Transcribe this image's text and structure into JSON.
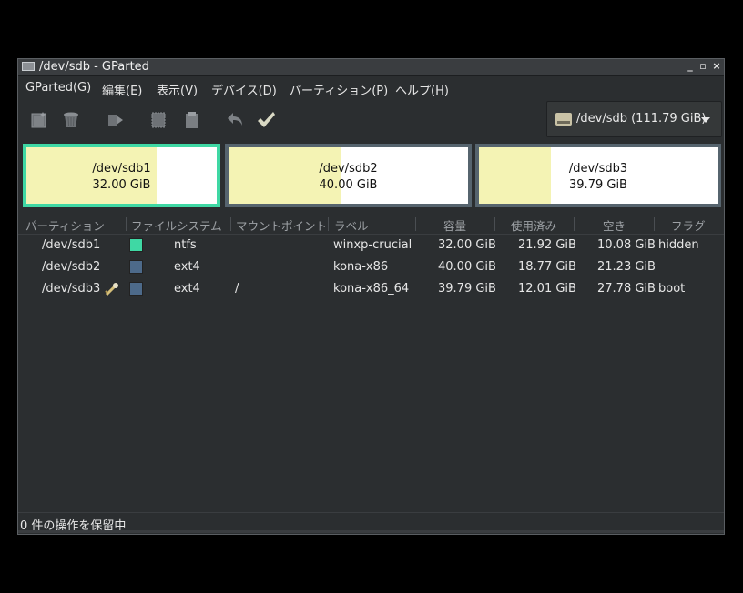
{
  "window": {
    "title": "/dev/sdb - GParted"
  },
  "menu": [
    "GParted(G)",
    "編集(E)",
    "表示(V)",
    "デバイス(D)",
    "パーティション(P)",
    "ヘルプ(H)"
  ],
  "toolbar": {
    "icons": [
      "new-partition-icon",
      "delete-icon",
      "resize-move-icon",
      "copy-icon",
      "paste-icon",
      "undo-icon",
      "apply-icon"
    ]
  },
  "device": {
    "label": "/dev/sdb   (111.79 GiB)",
    "icon": "harddisk-icon"
  },
  "partitions_map": [
    {
      "name": "/dev/sdb1",
      "size": "32.00 GiB",
      "used_fraction": 0.685,
      "selected": true
    },
    {
      "name": "/dev/sdb2",
      "size": "40.00 GiB",
      "used_fraction": 0.469,
      "selected": false
    },
    {
      "name": "/dev/sdb3",
      "size": "39.79 GiB",
      "used_fraction": 0.302,
      "selected": false
    }
  ],
  "columns": [
    "パーティション",
    "ファイルシステム",
    "マウントポイント",
    "ラベル",
    "容量",
    "使用済み",
    "空き",
    "フラグ"
  ],
  "rows": [
    {
      "partition": "/dev/sdb1",
      "locked": false,
      "fs_color": "#3fd8a4",
      "fs": "ntfs",
      "mount": "",
      "label": "winxp-crucial",
      "size": "32.00 GiB",
      "used": "21.92 GiB",
      "free": "10.08 GiB",
      "flags": "hidden"
    },
    {
      "partition": "/dev/sdb2",
      "locked": false,
      "fs_color": "#4d6a8a",
      "fs": "ext4",
      "mount": "",
      "label": "kona-x86",
      "size": "40.00 GiB",
      "used": "18.77 GiB",
      "free": "21.23 GiB",
      "flags": ""
    },
    {
      "partition": "/dev/sdb3",
      "locked": true,
      "fs_color": "#4d6a8a",
      "fs": "ext4",
      "mount": "/",
      "label": "kona-x86_64",
      "size": "39.79 GiB",
      "used": "12.01 GiB",
      "free": "27.78 GiB",
      "flags": "boot"
    }
  ],
  "status": {
    "text": "0 件の操作を保留中"
  }
}
